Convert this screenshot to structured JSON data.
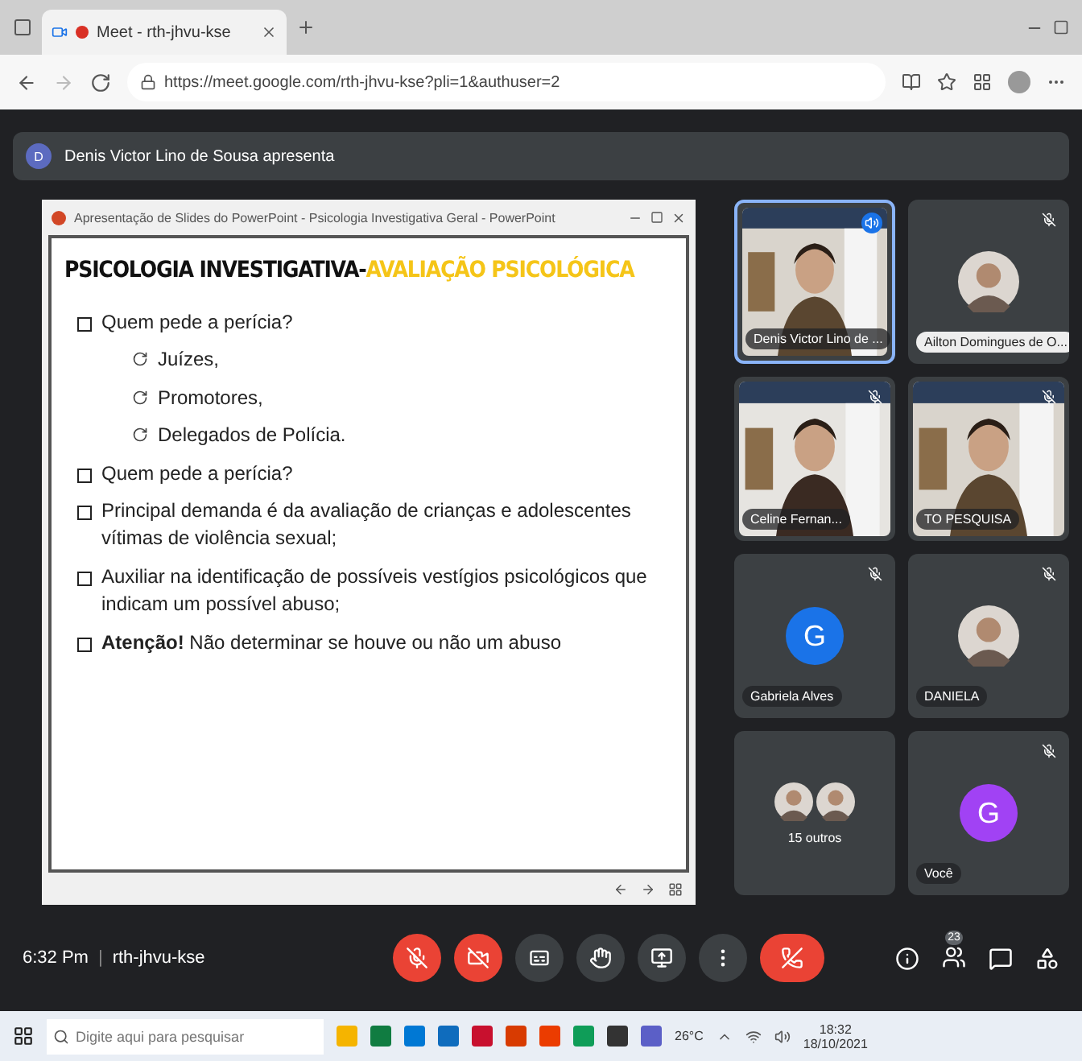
{
  "browser": {
    "tab_title": "Meet - rth-jhvu-kse",
    "url": "https://meet.google.com/rth-jhvu-kse?pli=1&authuser=2"
  },
  "banner": {
    "avatar_letter": "D",
    "text": "Denis Victor Lino de Sousa apresenta"
  },
  "presentation": {
    "window_title": "Apresentação de Slides do PowerPoint - Psicologia Investigativa Geral - PowerPoint",
    "title_dark": "PSICOLOGIA INVESTIGATIVA-",
    "title_highlight": "AVALIAÇÃO PSICOLÓGICA",
    "bullets": [
      {
        "kind": "square",
        "text": "Quem pede a perícia?"
      },
      {
        "kind": "sub",
        "text": "Juízes,"
      },
      {
        "kind": "sub",
        "text": "Promotores,"
      },
      {
        "kind": "sub",
        "text": "Delegados de Polícia."
      },
      {
        "kind": "square",
        "text": "Quem pede a perícia?"
      },
      {
        "kind": "square",
        "text": "Principal demanda é da avaliação de crianças e adolescentes vítimas de violência sexual;"
      },
      {
        "kind": "square",
        "text": "Auxiliar na identificação de possíveis vestígios psicológicos que indicam um possível abuso;"
      },
      {
        "kind": "square",
        "text": "**Atenção!** Não determinar se houve ou não um abuso"
      }
    ]
  },
  "tiles": [
    {
      "kind": "video",
      "name": "Denis Victor Lino de ...",
      "muted": false,
      "speaking": true
    },
    {
      "name": "Ailton Domingues de O...",
      "muted": true,
      "speaking": false
    },
    {
      "kind": "video",
      "name": "Celine Fernan...",
      "muted": true,
      "speaking": false
    },
    {
      "kind": "video",
      "name": "TO PESQUISA",
      "muted": true,
      "speaking": false
    },
    {
      "kind": "letter",
      "letter": "G",
      "color": "#1a73e8",
      "name": "Gabriela Alves",
      "muted": true,
      "speaking": false
    },
    {
      "name": "DANIELA",
      "muted": true,
      "speaking": false
    },
    {
      "kind": "group",
      "name": "15 outros",
      "muted": false,
      "speaking": false
    },
    {
      "kind": "letter",
      "letter": "G",
      "color": "#a142f4",
      "name": "Você",
      "muted": true,
      "speaking": false
    }
  ],
  "meeting": {
    "time": "6:32 Pm",
    "separator": "|",
    "code": "rth-jhvu-kse",
    "participants": "23"
  },
  "controls": [
    {
      "kind": "mic",
      "off": true
    },
    {
      "kind": "camera",
      "off": true
    },
    {
      "kind": "captions",
      "off": false
    },
    {
      "kind": "hand",
      "off": false
    },
    {
      "kind": "present",
      "off": false
    },
    {
      "kind": "more",
      "off": false
    },
    {
      "kind": "hangup"
    }
  ],
  "taskbar": {
    "search_placeholder": "Digite aqui para pesquisar",
    "weather": "26°C",
    "time": "18:32",
    "date": "18/10/2021"
  }
}
